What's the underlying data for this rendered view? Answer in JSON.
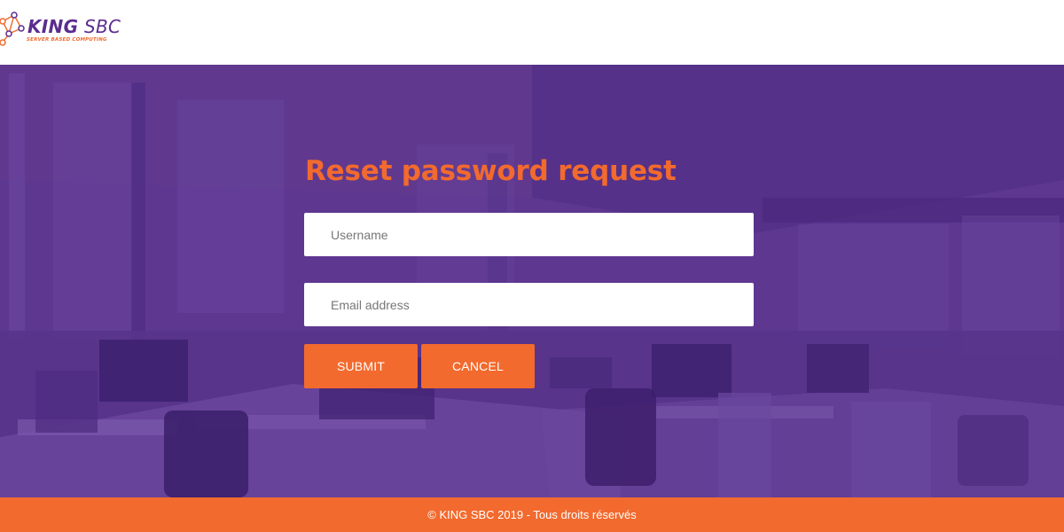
{
  "header": {
    "logo": {
      "name_bold": "KING",
      "name_regular": " SBC",
      "tagline": "SERVER BASED COMPUTING"
    }
  },
  "form": {
    "title": "Reset password request",
    "username_placeholder": "Username",
    "email_placeholder": "Email address",
    "submit_label": "SUBMIT",
    "cancel_label": "CANCEL"
  },
  "footer": {
    "text": "© KING SBC 2019 - Tous droits réservés"
  },
  "colors": {
    "brand_purple": "#5e3791",
    "accent_orange": "#f26a2e"
  },
  "icons": {
    "logo_mark": "network-nodes-icon"
  }
}
